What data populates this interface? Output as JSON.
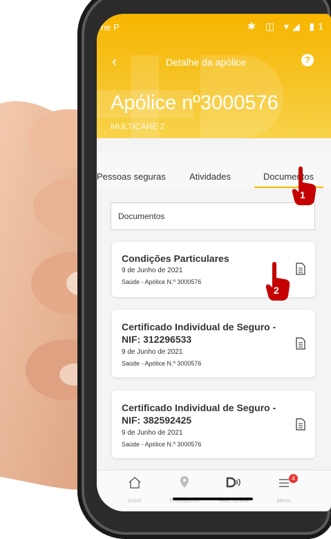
{
  "status": {
    "carrier": "ne P",
    "icons": "✱ ◫ ▾◢ ▮1"
  },
  "header": {
    "title": "Detalhe da apólice",
    "policy": "Apólice nº3000576",
    "product": "MULTICARE 2",
    "help": "?"
  },
  "tabs": [
    {
      "label": "Pessoas seguras"
    },
    {
      "label": "Atividades"
    },
    {
      "label": "Documentos",
      "active": true
    }
  ],
  "filter": {
    "value": "Documentos"
  },
  "documents": [
    {
      "title": "Condições Particulares",
      "date": "9 de Junho de 2021",
      "subtitle": "Saúde - Apólice N.º 3000576"
    },
    {
      "title_line1": "Certificado Individual de Seguro -",
      "title_line2": "NIF: 312296533",
      "date": "9 de Junho de 2021",
      "subtitle": "Saúde - Apólice N.º 3000576"
    },
    {
      "title_line1": "Certificado Individual de Seguro -",
      "title_line2": "NIF: 382592425",
      "date": "9 de Junho de 2021",
      "subtitle": "Saúde - Apólice N.º 3000576"
    }
  ],
  "nav": [
    {
      "label": "Início",
      "icon": "home-icon"
    },
    {
      "label": "Prestadores",
      "icon": "location-pin-icon"
    },
    {
      "label": "Med. Online",
      "icon": "med-online-icon"
    },
    {
      "label": "Menu",
      "icon": "menu-icon",
      "badge": "4"
    }
  ],
  "markers": [
    {
      "number": "1"
    },
    {
      "number": "2"
    }
  ],
  "colors": {
    "brand": "#f7b500",
    "badge": "#e53935",
    "marker": "#c40000"
  }
}
